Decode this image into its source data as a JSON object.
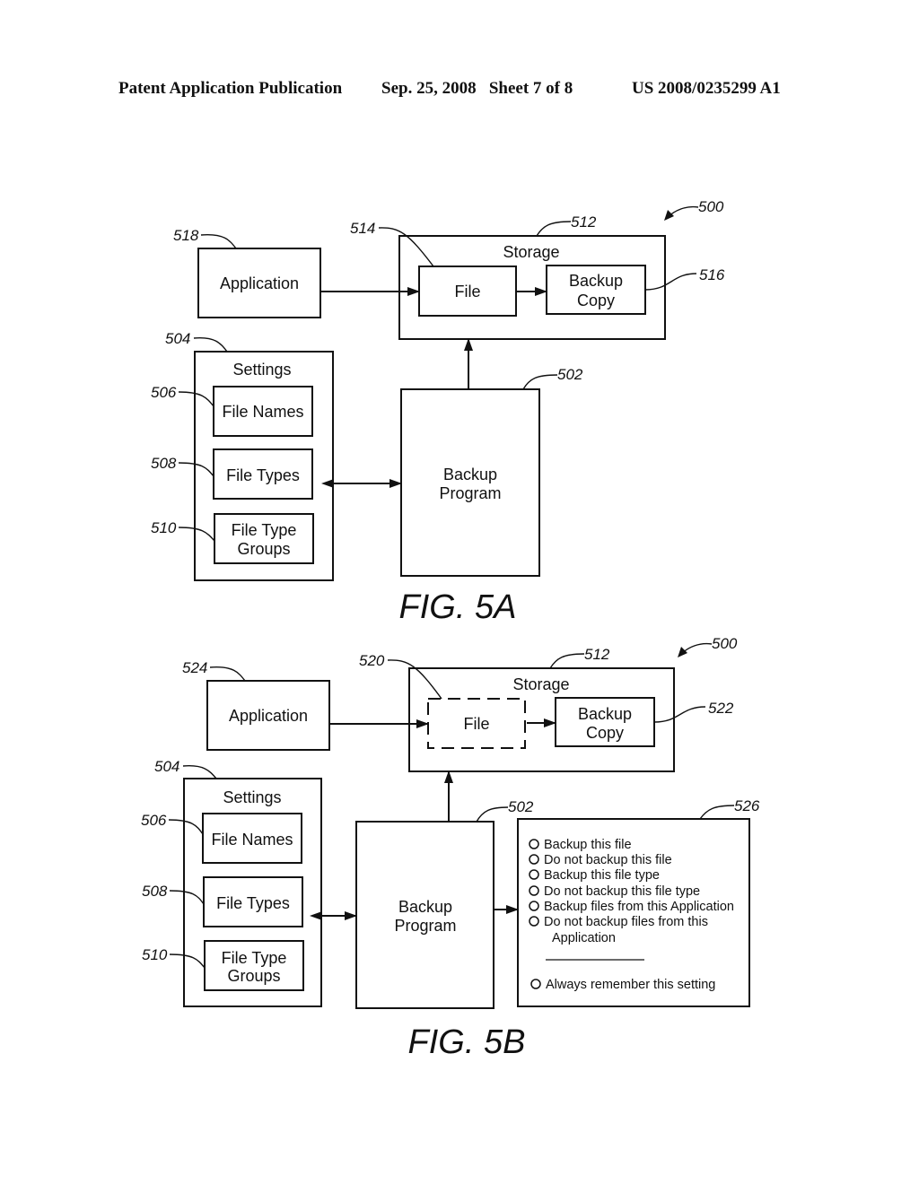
{
  "header": {
    "publication": "Patent Application Publication",
    "date_sheet": "Sep. 25, 2008   Sheet 7 of 8",
    "number": "US 2008/0235299 A1"
  },
  "fig5a": {
    "caption": "FIG. 5A",
    "system_ref": "500",
    "application": {
      "label": "Application",
      "ref": "518"
    },
    "storage": {
      "label": "Storage",
      "ref": "512"
    },
    "file": {
      "label": "File",
      "ref": "514"
    },
    "backup_copy": {
      "line1": "Backup",
      "line2": "Copy",
      "ref": "516"
    },
    "settings": {
      "label": "Settings",
      "ref": "504"
    },
    "file_names": {
      "label": "File Names",
      "ref": "506"
    },
    "file_types": {
      "label": "File Types",
      "ref": "508"
    },
    "file_type_groups": {
      "line1": "File Type",
      "line2": "Groups",
      "ref": "510"
    },
    "backup_program": {
      "line1": "Backup",
      "line2": "Program",
      "ref": "502"
    }
  },
  "fig5b": {
    "caption": "FIG. 5B",
    "system_ref": "500",
    "application": {
      "label": "Application",
      "ref": "524"
    },
    "storage": {
      "label": "Storage",
      "ref": "512"
    },
    "file": {
      "label": "File",
      "ref": "520"
    },
    "backup_copy": {
      "line1": "Backup",
      "line2": "Copy",
      "ref": "522"
    },
    "settings": {
      "label": "Settings",
      "ref": "504"
    },
    "file_names": {
      "label": "File Names",
      "ref": "506"
    },
    "file_types": {
      "label": "File Types",
      "ref": "508"
    },
    "file_type_groups": {
      "line1": "File Type",
      "line2": "Groups",
      "ref": "510"
    },
    "backup_program": {
      "line1": "Backup",
      "line2": "Program",
      "ref": "502"
    },
    "dialog": {
      "ref": "526",
      "options": [
        "Backup this file",
        "Do not backup this file",
        "Backup this file type",
        "Do not backup this file type",
        "Backup files from this Application",
        "Do not backup files from this"
      ],
      "option_continuation": "Application",
      "remember": "Always remember this setting"
    }
  }
}
